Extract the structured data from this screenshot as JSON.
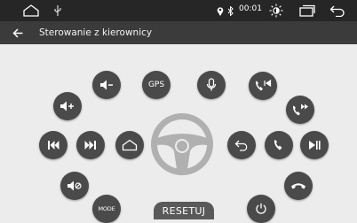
{
  "status_bar": {
    "time": "00:01"
  },
  "header": {
    "title": "Sterowanie z kierownicy"
  },
  "buttons": {
    "gps": "GPS",
    "mode": "MODE"
  },
  "reset_label": "RESETUJ",
  "colors": {
    "status_bar_bg": "#262626",
    "title_bar_bg": "#3b3b3b",
    "content_bg": "#ececec",
    "button_bg": "#4a4a4a",
    "wheel_color": "#c4c4c4"
  }
}
